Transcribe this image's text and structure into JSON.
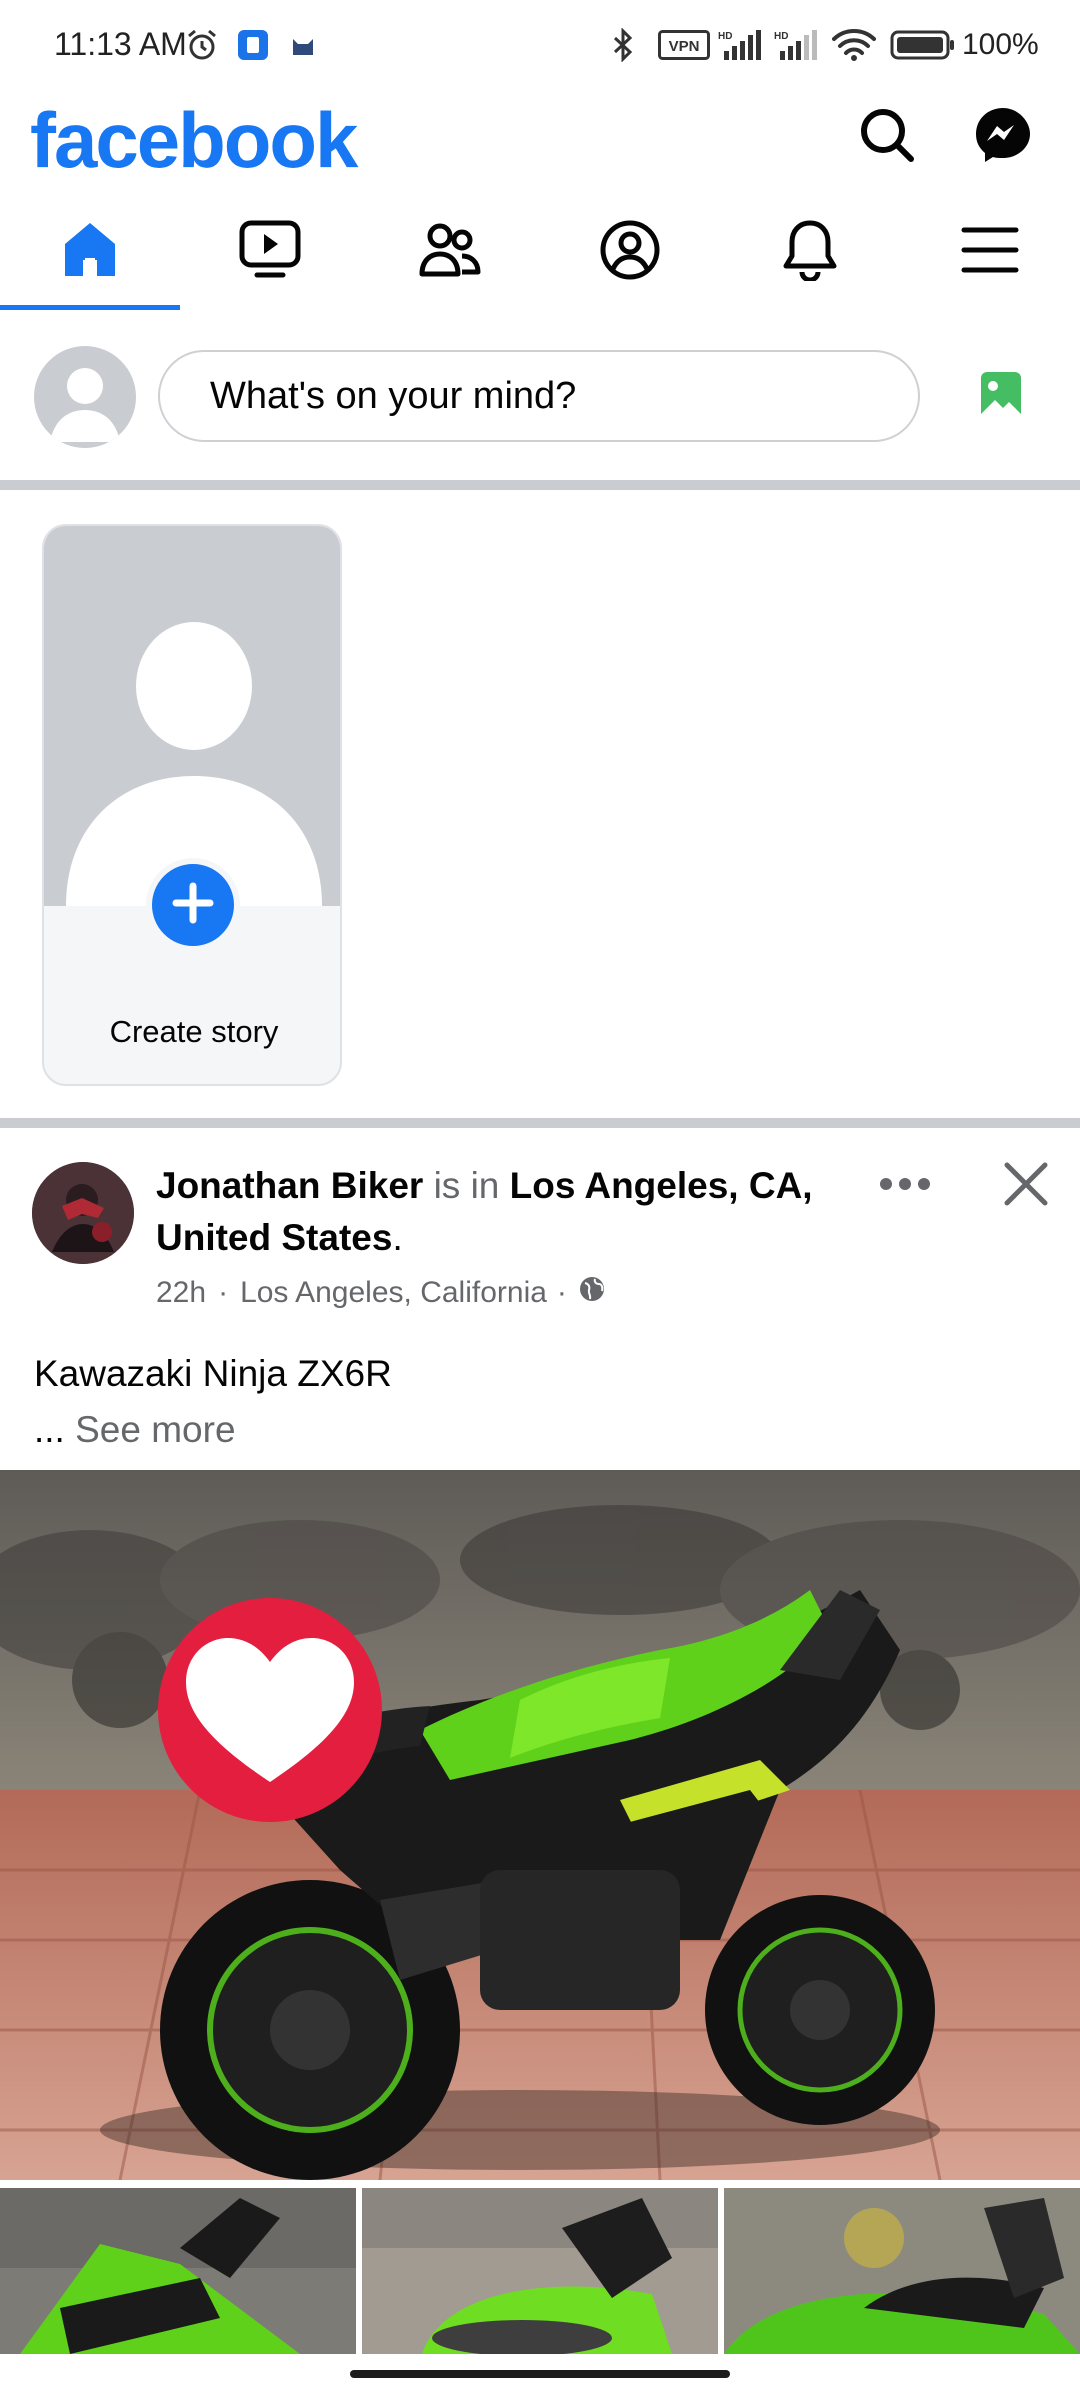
{
  "status_bar": {
    "time": "11:13 AM",
    "battery": "100%",
    "icons": [
      "alarm-icon",
      "app-notification-icon",
      "cat-icon",
      "bluetooth-icon",
      "vpn-icon",
      "signal-hd-icon",
      "signal-hd-icon",
      "wifi-icon",
      "battery-icon"
    ],
    "vpn_label": "VPN"
  },
  "header": {
    "logo": "facebook",
    "brand_color": "#1877F2",
    "search_icon": "search-icon",
    "messenger_icon": "messenger-icon"
  },
  "nav_tabs": [
    {
      "name": "home",
      "icon": "home-icon",
      "active": true
    },
    {
      "name": "video",
      "icon": "video-icon",
      "active": false
    },
    {
      "name": "friends",
      "icon": "friends-icon",
      "active": false
    },
    {
      "name": "profile",
      "icon": "profile-icon",
      "active": false
    },
    {
      "name": "notifications",
      "icon": "bell-icon",
      "active": false
    },
    {
      "name": "menu",
      "icon": "hamburger-icon",
      "active": false
    }
  ],
  "composer": {
    "placeholder": "What's on your mind?",
    "photo_icon": "photo-icon"
  },
  "stories": {
    "create_label": "Create story"
  },
  "post": {
    "author": "Jonathan Biker",
    "verb": "is in",
    "location_full": "Los Angeles, CA, United States",
    "location_suffix": ".",
    "time": "22h",
    "separator": "·",
    "location_short": "Los Angeles, California",
    "location_dot": "·",
    "privacy_icon": "globe-icon",
    "text": "Kawazaki Ninja ZX6R",
    "ellipsis": "...",
    "see_more": "See more",
    "reaction_icon": "heart-reaction-icon"
  }
}
